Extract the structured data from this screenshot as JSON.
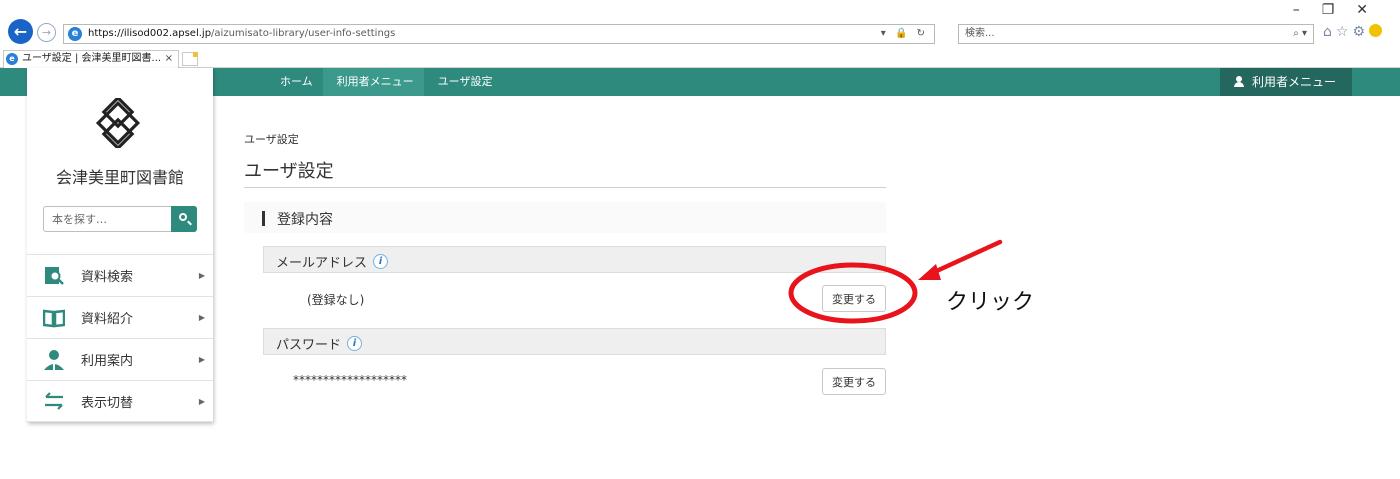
{
  "browser": {
    "url_host": "https://ilisod002.apsel.jp",
    "url_path": "/aizumisato-library/user-info-settings",
    "search_placeholder": "検索...",
    "tab_title": "ユーザ設定 | 会津美里町図書...",
    "tab_close": "×"
  },
  "header": {
    "crumbs": [
      "ホーム",
      "利用者メニュー",
      "ユーザ設定"
    ],
    "user_menu": "利用者メニュー"
  },
  "sidebar": {
    "library_name": "会津美里町図書館",
    "search_placeholder": "本を探す…",
    "items": [
      {
        "label": "資料検索",
        "icon": "search-book-icon"
      },
      {
        "label": "資料紹介",
        "icon": "open-book-icon"
      },
      {
        "label": "利用案内",
        "icon": "person-guide-icon"
      },
      {
        "label": "表示切替",
        "icon": "switch-arrows-icon"
      }
    ]
  },
  "main": {
    "breadcrumb": "ユーザ設定",
    "title": "ユーザ設定",
    "section": "登録内容",
    "fields": [
      {
        "label": "メールアドレス",
        "value": "(登録なし)",
        "button": "変更する"
      },
      {
        "label": "パスワード",
        "value": "*******************",
        "button": "変更する"
      }
    ]
  },
  "annotation": {
    "label": "クリック",
    "color": "#e8131b"
  },
  "colors": {
    "header": "#2f8a7e",
    "user_menu_bg": "#24675e",
    "accent": "#2f8a7e"
  }
}
